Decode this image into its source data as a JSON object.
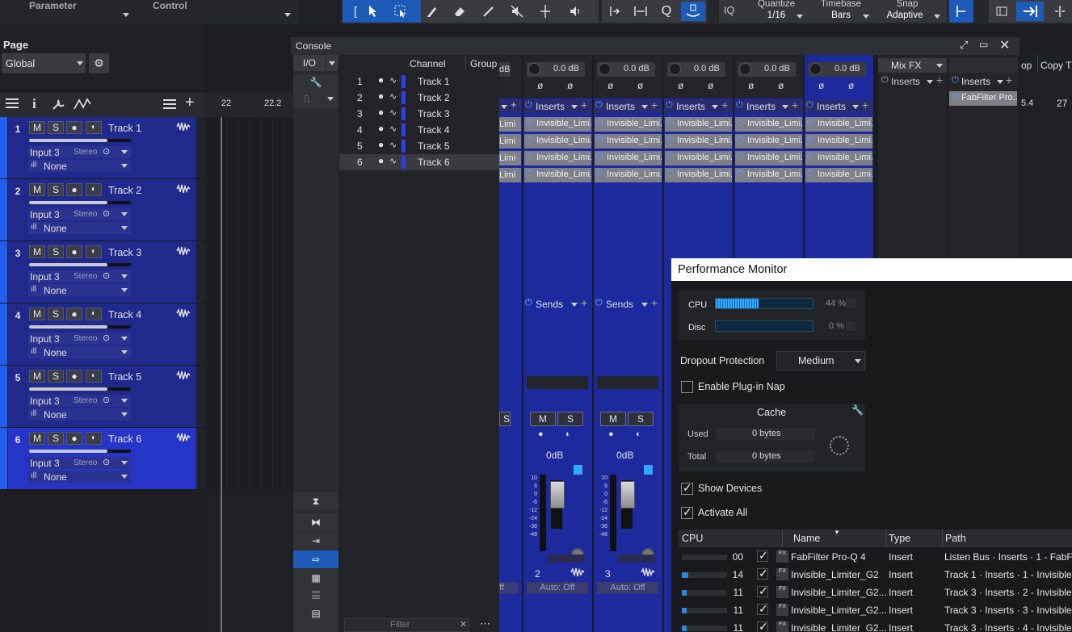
{
  "toolbar": {
    "parameter": "Parameter",
    "control": "Control",
    "iq": "IQ",
    "quantize_label": "Quantize",
    "quantize_value": "1/16",
    "timebase_label": "Timebase",
    "timebase_value": "Bars",
    "snap_label": "Snap",
    "snap_value": "Adaptive"
  },
  "page_panel": {
    "title": "Page",
    "select_value": "Global"
  },
  "timeline": {
    "marker_1": "22",
    "marker_2": "22.2"
  },
  "tracks": [
    {
      "num": "1",
      "name": "Track 1",
      "input": "Input 3",
      "stereo": "Stereo",
      "output": "None"
    },
    {
      "num": "2",
      "name": "Track 2",
      "input": "Input 3",
      "stereo": "Stereo",
      "output": "None"
    },
    {
      "num": "3",
      "name": "Track 3",
      "input": "Input 3",
      "stereo": "Stereo",
      "output": "None"
    },
    {
      "num": "4",
      "name": "Track 4",
      "input": "Input 3",
      "stereo": "Stereo",
      "output": "None"
    },
    {
      "num": "5",
      "name": "Track 5",
      "input": "Input 3",
      "stereo": "Stereo",
      "output": "None"
    },
    {
      "num": "6",
      "name": "Track 6",
      "input": "Input 3",
      "stereo": "Stereo",
      "output": "None"
    }
  ],
  "track_buttons": {
    "mute": "M",
    "solo": "S"
  },
  "console": {
    "title": "Console",
    "io_tab": "I/O",
    "col_channel": "Channel",
    "col_group": "Group",
    "filter_placeholder": "Filter",
    "channels": [
      {
        "num": "1",
        "name": "Track 1"
      },
      {
        "num": "2",
        "name": "Track 2"
      },
      {
        "num": "3",
        "name": "Track 3"
      },
      {
        "num": "4",
        "name": "Track 4"
      },
      {
        "num": "5",
        "name": "Track 5"
      },
      {
        "num": "6",
        "name": "Track 6"
      }
    ],
    "partial_strip": {
      "db": "dB",
      "slot": "Limi",
      "ms_s": "S",
      "auto": "ff"
    },
    "strips": [
      {
        "db": "0.0 dB",
        "inserts": "Inserts",
        "slot": "Invisible_Limi...",
        "sends": "Sends",
        "label": "0dB",
        "number": "2",
        "auto": "Auto: Off"
      },
      {
        "db": "0.0 dB",
        "inserts": "Inserts",
        "slot": "Invisible_Limi...",
        "sends": "Sends",
        "label": "0dB",
        "number": "3",
        "auto": "Auto: Off"
      },
      {
        "db": "0.0 dB",
        "inserts": "Inserts",
        "slot": "Invisible_Limi..."
      },
      {
        "db": "0.0 dB",
        "inserts": "Inserts",
        "slot": "Invisible_Limi..."
      },
      {
        "db": "0.0 dB",
        "inserts": "Inserts",
        "slot": "Invisible_Limi..."
      }
    ],
    "mute_label": "M",
    "solo_label": "S",
    "meter_scale": [
      "10",
      "6",
      "0",
      "-6",
      "-12",
      "-24",
      "-36",
      "-48"
    ],
    "mixfx": {
      "title": "Mix FX",
      "inserts": "Inserts"
    },
    "listen": {
      "inserts": "Inserts",
      "plugin": "FabFilter Pro..."
    },
    "right_edge": {
      "op": "op",
      "copy": "Copy T",
      "ruler_a": "5.4",
      "ruler_b": "27"
    }
  },
  "performance_monitor": {
    "title": "Performance Monitor",
    "cpu_label": "CPU",
    "cpu_value": "44 %",
    "cpu_level": 0.44,
    "disc_label": "Disc",
    "disc_value": "0 %",
    "disc_level": 0,
    "dropout_label": "Dropout Protection",
    "dropout_value": "Medium",
    "plugin_nap_label": "Enable Plug-in Nap",
    "cache_title": "Cache",
    "cache_used_label": "Used",
    "cache_used_value": "0 bytes",
    "cache_total_label": "Total",
    "cache_total_value": "0 bytes",
    "show_devices_label": "Show Devices",
    "activate_all_label": "Activate All",
    "columns": {
      "cpu": "CPU",
      "name": "Name",
      "type": "Type",
      "path": "Path"
    },
    "rows": [
      {
        "cpu_level": 0.0,
        "cpu": "00",
        "fx": "FX",
        "name": "FabFilter Pro-Q 4",
        "type": "Insert",
        "path": "Listen Bus · Inserts · 1 - FabF"
      },
      {
        "cpu_level": 0.14,
        "cpu": "14",
        "fx": "FX",
        "name": "Invisible_Limiter_G2",
        "type": "Insert",
        "path": "Track 1 · Inserts · 1 - Invisible"
      },
      {
        "cpu_level": 0.11,
        "cpu": "11",
        "fx": "FX",
        "name": "Invisible_Limiter_G2...",
        "type": "Insert",
        "path": "Track 3 · Inserts · 2 - Invisible"
      },
      {
        "cpu_level": 0.11,
        "cpu": "11",
        "fx": "FX",
        "name": "Invisible_Limiter_G2...",
        "type": "Insert",
        "path": "Track 3 · Inserts · 3 - Invisible"
      },
      {
        "cpu_level": 0.11,
        "cpu": "11",
        "fx": "FX",
        "name": "Invisible_Limiter_G2...",
        "type": "Insert",
        "path": "Track 3 · Inserts · 4 - Invisible"
      }
    ]
  },
  "colors": {
    "accent": "#1f5ef0",
    "selected_track": "#1f2a8c",
    "mixer_strip": "#1d2a9e",
    "toolbar_active": "#1e5ab8"
  }
}
